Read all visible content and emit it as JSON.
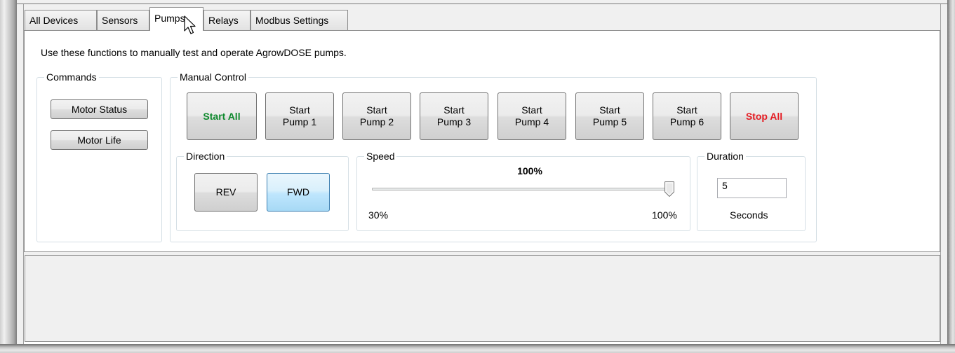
{
  "tabs": [
    "All Devices",
    "Sensors",
    "Pumps",
    "Relays",
    "Modbus Settings"
  ],
  "active_tab": "Pumps",
  "description": "Use these functions to manually test and operate AgrowDOSE pumps.",
  "commands": {
    "title": "Commands",
    "motor_status": "Motor Status",
    "motor_life": "Motor Life"
  },
  "manual_control": {
    "title": "Manual Control",
    "start_all": "Start All",
    "pumps": [
      {
        "line1": "Start",
        "line2": "Pump 1"
      },
      {
        "line1": "Start",
        "line2": "Pump 2"
      },
      {
        "line1": "Start",
        "line2": "Pump 3"
      },
      {
        "line1": "Start",
        "line2": "Pump 4"
      },
      {
        "line1": "Start",
        "line2": "Pump 5"
      },
      {
        "line1": "Start",
        "line2": "Pump 6"
      }
    ],
    "stop_all": "Stop All"
  },
  "direction": {
    "title": "Direction",
    "rev": "REV",
    "fwd": "FWD",
    "selected": "FWD"
  },
  "speed": {
    "title": "Speed",
    "value_label": "100%",
    "min_label": "30%",
    "max_label": "100%",
    "value": 100,
    "min": 30,
    "max": 100
  },
  "duration": {
    "title": "Duration",
    "value": "5",
    "unit": "Seconds"
  },
  "colors": {
    "start_all": "#0f8a2e",
    "stop_all": "#e51c23",
    "selected_button": "#bee6fd"
  }
}
